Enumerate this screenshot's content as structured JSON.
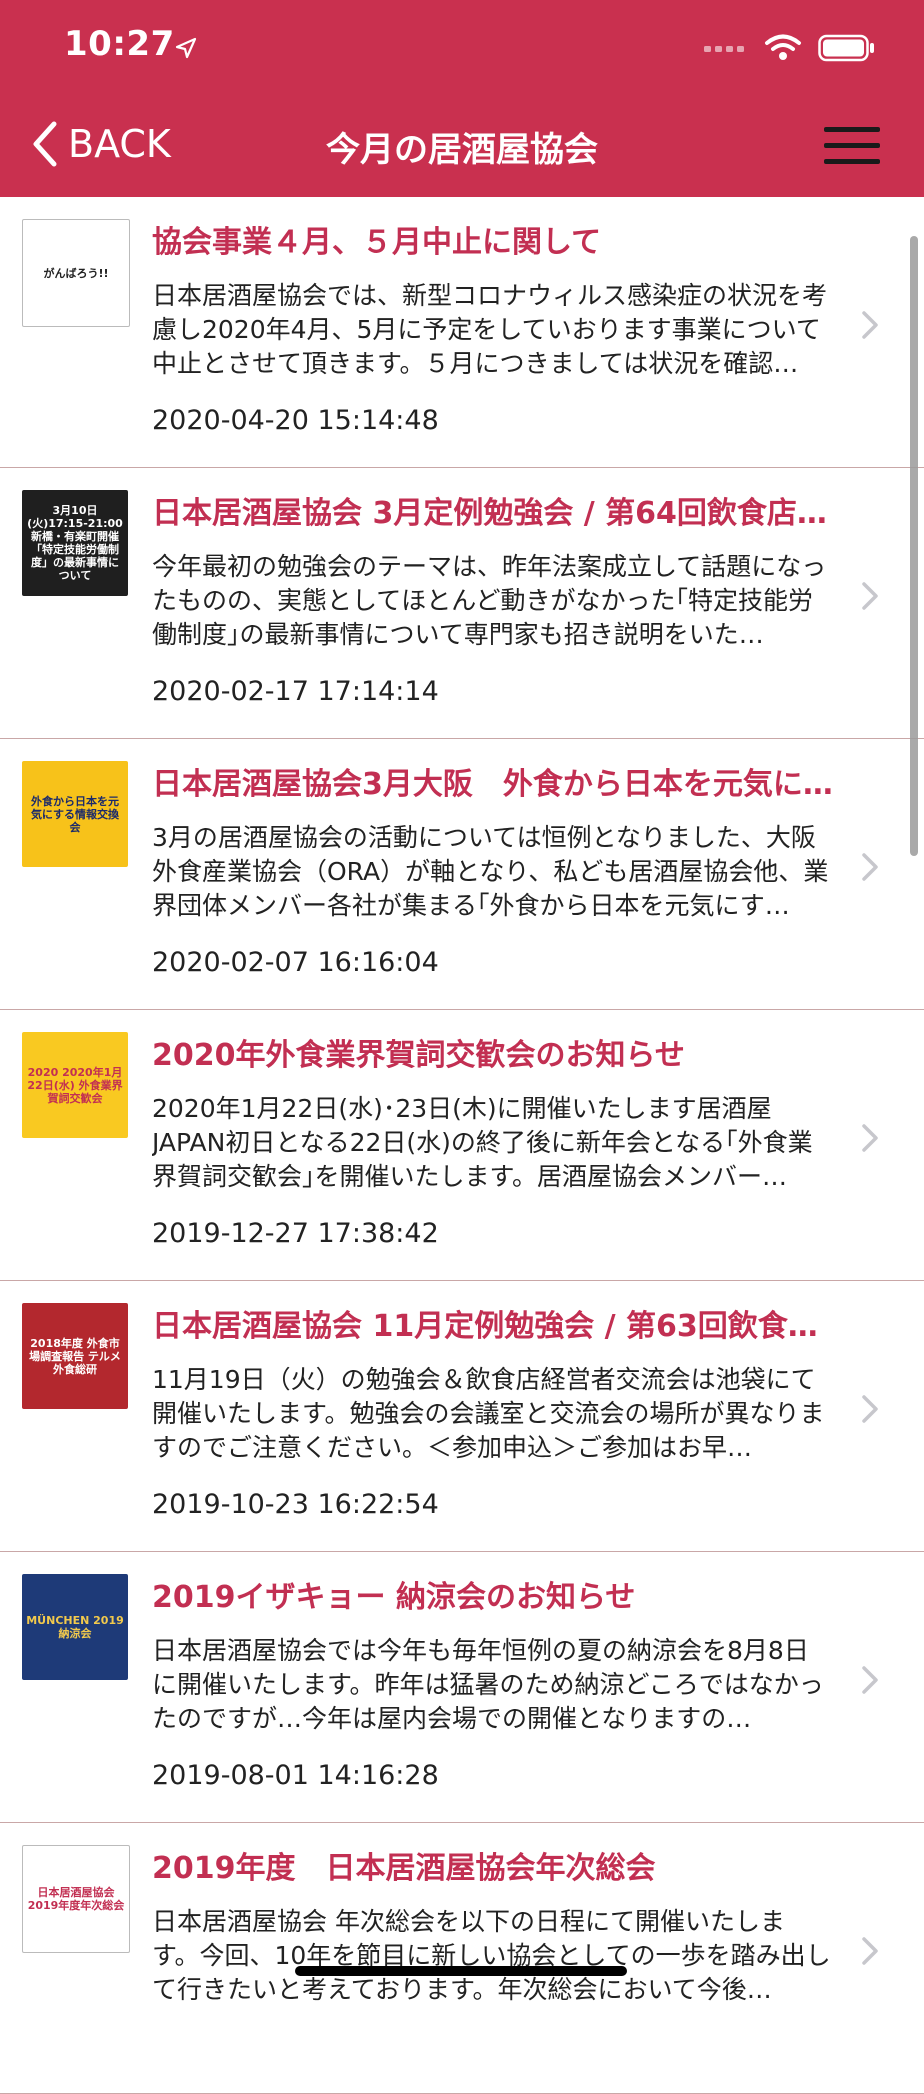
{
  "status_bar": {
    "time": "10:27",
    "signal_icon": "signal-bars-icon",
    "wifi_icon": "wifi-icon",
    "battery_icon": "battery-icon"
  },
  "navbar": {
    "back_label": "BACK",
    "title": "今月の居酒屋協会",
    "menu_icon": "hamburger-menu-icon",
    "bg_color": "#c9304f"
  },
  "items": [
    {
      "title": "協会事業４月、５月中止に関して",
      "desc": "日本居酒屋協会では、新型コロナウィルス感染症の状況を考慮し2020年4月、5月に予定をしていおります事業について中止とさせて頂きます。５月につきましては状況を確認…",
      "date": "2020-04-20 15:14:48",
      "thumb_text": "がんばろう!!",
      "thumb_bg": "#ffffff",
      "thumb_fg": "#222222"
    },
    {
      "title": "日本居酒屋協会 3月定例勉強会 / 第64回飲食店…",
      "desc": "今年最初の勉強会のテーマは、昨年法案成立して話題になったものの、実態としてほとんど動きがなかった｢特定技能労働制度｣の最新事情について専門家も招き説明をいた…",
      "date": "2020-02-17 17:14:14",
      "thumb_text": "3月10日(火)17:15-21:00 新橋・有楽町開催 「特定技能労働制度」の最新事情について",
      "thumb_bg": "#1f1f1f",
      "thumb_fg": "#ffffff"
    },
    {
      "title": "日本居酒屋協会3月大阪　外食から日本を元気に…",
      "desc": "3月の居酒屋協会の活動については恒例となりました、大阪外食産業協会（ORA）が軸となり、私ども居酒屋協会他、業界団体メンバー各社が集まる｢外食から日本を元気にす…",
      "date": "2020-02-07 16:16:04",
      "thumb_text": "外食から日本を元気にする情報交換会",
      "thumb_bg": "#f7c21a",
      "thumb_fg": "#1b2a6b"
    },
    {
      "title": "2020年外食業界賀詞交歓会のお知らせ",
      "desc": "2020年1月22日(水)･23日(木)に開催いたします居酒屋JAPAN初日となる22日(水)の終了後に新年会となる｢外食業界賀詞交歓会｣を開催いたします。居酒屋協会メンバー…",
      "date": "2019-12-27 17:38:42",
      "thumb_text": "2020 2020年1月22日(水) 外食業界 賀詞交歓会",
      "thumb_bg": "#f9c921",
      "thumb_fg": "#c22f52"
    },
    {
      "title": "日本居酒屋協会 11月定例勉強会 / 第63回飲食…",
      "desc": "11月19日（火）の勉強会＆飲食店経営者交流会は池袋にて開催いたします。勉強会の会議室と交流会の場所が異なりますのでご注意ください。＜参加申込＞ご参加はお早…",
      "date": "2019-10-23 16:22:54",
      "thumb_text": "2018年度 外食市場調査報告 テルメ外食総研",
      "thumb_bg": "#b3282e",
      "thumb_fg": "#ffffff"
    },
    {
      "title": "2019イザキョー 納涼会のお知らせ",
      "desc": "日本居酒屋協会では今年も毎年恒例の夏の納涼会を8月8日に開催いたします。昨年は猛暑のため納涼どころではなかったのですが…今年は屋内会場での開催となりますの…",
      "date": "2019-08-01 14:16:28",
      "thumb_text": "MÜNCHEN 2019納涼会",
      "thumb_bg": "#1e3a78",
      "thumb_fg": "#f2c94c"
    },
    {
      "title": "2019年度　日本居酒屋協会年次総会",
      "desc": "日本居酒屋協会 年次総会を以下の日程にて開催いたします。今回、10年を節目に新しい協会としての一歩を踏み出して行きたいと考えております。年次総会において今後…",
      "date": "",
      "thumb_text": "日本居酒屋協会 2019年度年次総会",
      "thumb_bg": "#ffffff",
      "thumb_fg": "#c22f52"
    }
  ]
}
